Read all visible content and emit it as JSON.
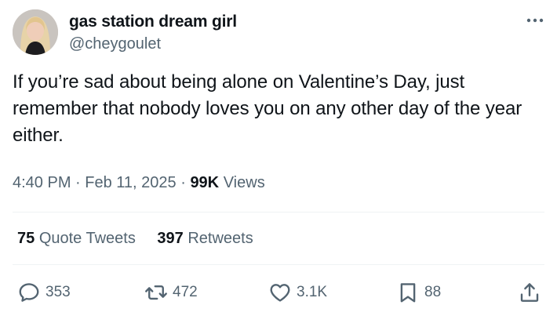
{
  "author": {
    "display_name": "gas station dream girl",
    "handle": "@cheygoulet"
  },
  "tweet": {
    "text": "If you’re sad about being alone on Valentine’s Day, just remember that nobody loves you on any other day of the year either."
  },
  "meta": {
    "time": "4:40 PM",
    "date": "Feb 11, 2025",
    "views_count": "99K",
    "views_label": "Views"
  },
  "stats": {
    "quote_tweets_count": "75",
    "quote_tweets_label": "Quote Tweets",
    "retweets_count": "397",
    "retweets_label": "Retweets"
  },
  "actions": {
    "replies": "353",
    "retweets": "472",
    "likes": "3.1K",
    "bookmarks": "88"
  },
  "icons": {
    "more": "more-dots-icon",
    "reply": "reply-bubble-icon",
    "retweet": "retweet-icon",
    "like": "heart-icon",
    "bookmark": "bookmark-icon",
    "share": "share-icon"
  },
  "colors": {
    "text_primary": "#0f1419",
    "text_secondary": "#536471",
    "divider": "#eff3f4"
  }
}
